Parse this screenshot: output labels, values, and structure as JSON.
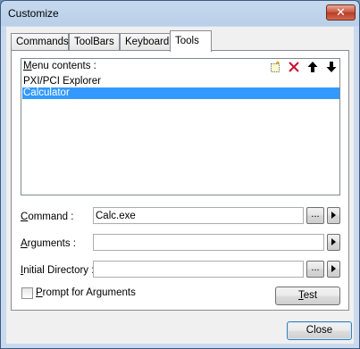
{
  "window": {
    "title": "Customize",
    "close_glyph": "✕"
  },
  "tabs": [
    {
      "label": "Commands"
    },
    {
      "label": "ToolBars"
    },
    {
      "label": "Keyboard"
    },
    {
      "label": "Tools",
      "active": true
    }
  ],
  "menu": {
    "label_prefix": "M",
    "label_rest": "enu contents :",
    "icons": [
      "new-item-icon",
      "delete-icon",
      "move-up-icon",
      "move-down-icon"
    ],
    "items": [
      {
        "label": "PXI/PCI Explorer",
        "selected": false
      },
      {
        "label": "Calculator",
        "selected": true
      }
    ]
  },
  "command": {
    "label_prefix": "C",
    "label_rest": "ommand :",
    "value": "Calc.exe",
    "browse_label": "...",
    "menu_icon": "right-arrow-icon"
  },
  "arguments": {
    "label_prefix": "A",
    "label_rest": "rguments :",
    "value": "",
    "menu_icon": "right-arrow-icon"
  },
  "initial_directory": {
    "label_prefix": "I",
    "label_rest": "nitial Directory :",
    "value": "",
    "browse_label": "...",
    "menu_icon": "right-arrow-icon"
  },
  "prompt": {
    "label_prefix": "P",
    "label_rest": "rompt for Arguments",
    "checked": false
  },
  "test_button": {
    "label_prefix": "T",
    "label_rest": "est"
  },
  "close_button": {
    "label": "Close"
  },
  "colors": {
    "selection": "#3399ff",
    "delete_icon": "#c8102e",
    "title_gradient_top": "#c7d9ee"
  }
}
